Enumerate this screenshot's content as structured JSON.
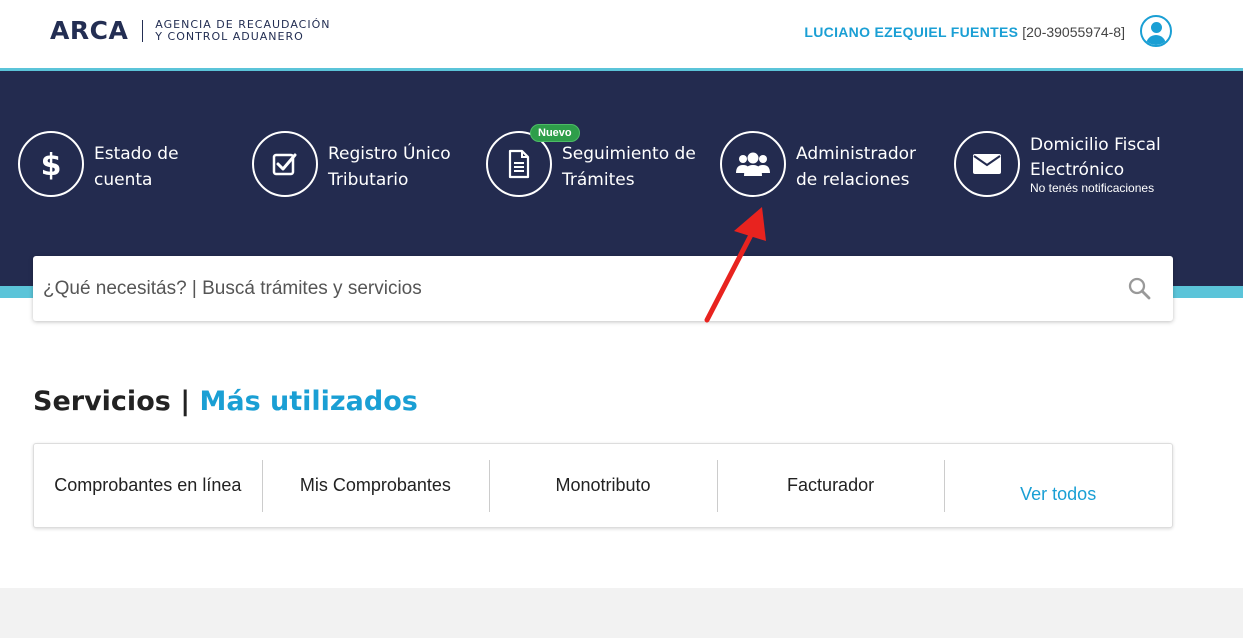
{
  "header": {
    "logo_mark": "ARCA",
    "logo_line1": "AGENCIA DE RECAUDACIÓN",
    "logo_line2": "Y CONTROL ADUANERO",
    "user_name": "LUCIANO EZEQUIEL FUENTES",
    "user_cuit": "[20-39055974-8]"
  },
  "shortcuts": [
    {
      "label_line1": "Estado de",
      "label_line2": "cuenta",
      "icon": "dollar-icon"
    },
    {
      "label_line1": "Registro Único",
      "label_line2": "Tributario",
      "icon": "checkbox-icon"
    },
    {
      "label_line1": "Seguimiento de",
      "label_line2": "Trámites",
      "icon": "document-icon",
      "badge": "Nuevo"
    },
    {
      "label_line1": "Administrador",
      "label_line2": "de relaciones",
      "icon": "users-icon"
    },
    {
      "label_line1": "Domicilio Fiscal",
      "label_line2": "Electrónico",
      "sub": "No tenés notificaciones",
      "icon": "envelope-icon"
    }
  ],
  "search": {
    "placeholder": "¿Qué necesitás? | Buscá trámites y servicios"
  },
  "services": {
    "title": "Servicios |",
    "title_accent": "Más utilizados",
    "items": [
      "Comprobantes en línea",
      "Mis Comprobantes",
      "Monotributo",
      "Facturador"
    ],
    "see_all": "Ver todos"
  },
  "colors": {
    "navy": "#232b4f",
    "accent": "#1a9fd4",
    "cyan": "#5bc4d9",
    "badge_green": "#2e9e4a",
    "annotation_arrow": "#e8231f"
  }
}
